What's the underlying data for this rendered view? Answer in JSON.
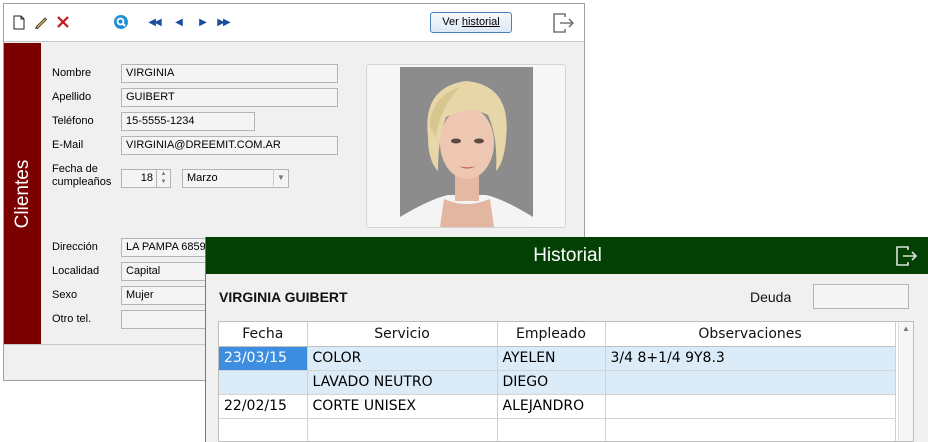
{
  "clientes_window": {
    "side_title": "Clientes",
    "toolbar": {
      "icons": [
        "new-document-icon",
        "edit-pencil-icon",
        "delete-x-icon",
        "search-icon",
        "first-record-icon",
        "previous-record-icon",
        "next-record-icon",
        "last-record-icon",
        "exit-icon"
      ],
      "glyphs": {
        "new": "🗋",
        "edit": "✎",
        "delete": "✕",
        "first": "◀◀",
        "prev": "◀",
        "next": "▶",
        "last": "▶▶"
      },
      "historial_prefix": "Ver ",
      "historial_underlined": "historial"
    },
    "labels": {
      "nombre": "Nombre",
      "apellido": "Apellido",
      "telefono": "Teléfono",
      "email": "E-Mail",
      "fecha_line1": "Fecha de",
      "fecha_line2": "cumpleaños",
      "direccion": "Dirección",
      "localidad": "Localidad",
      "sexo": "Sexo",
      "otro_tel": "Otro tel."
    },
    "values": {
      "nombre": "VIRGINIA",
      "apellido": "GUIBERT",
      "telefono": "15-5555-1234",
      "email": "VIRGINIA@DREEMIT.COM.AR",
      "dia": "18",
      "mes": "Marzo",
      "direccion": "LA PAMPA 6859",
      "localidad": "Capital",
      "sexo": "Mujer",
      "otro_tel": ""
    }
  },
  "historial_window": {
    "title": "Historial",
    "client_name": "VIRGINIA GUIBERT",
    "deuda_label": "Deuda",
    "deuda_value": "",
    "columns": [
      "Fecha",
      "Servicio",
      "Empleado",
      "Observaciones"
    ],
    "rows": [
      {
        "fecha": "23/03/15",
        "servicio": "COLOR",
        "empleado": "AYELEN",
        "observaciones": "3/4 8+1/4 9Y8.3"
      },
      {
        "fecha": "",
        "servicio": "LAVADO NEUTRO",
        "empleado": "DIEGO",
        "observaciones": ""
      },
      {
        "fecha": "22/02/15",
        "servicio": "CORTE UNISEX",
        "empleado": "ALEJANDRO",
        "observaciones": ""
      },
      {
        "fecha": "",
        "servicio": "",
        "empleado": "",
        "observaciones": ""
      }
    ]
  },
  "colors": {
    "sidebar_red": "#7b0000",
    "historial_green": "#034003",
    "selected_cell": "#3d8ee0",
    "selected_row": "#dbecf8"
  }
}
